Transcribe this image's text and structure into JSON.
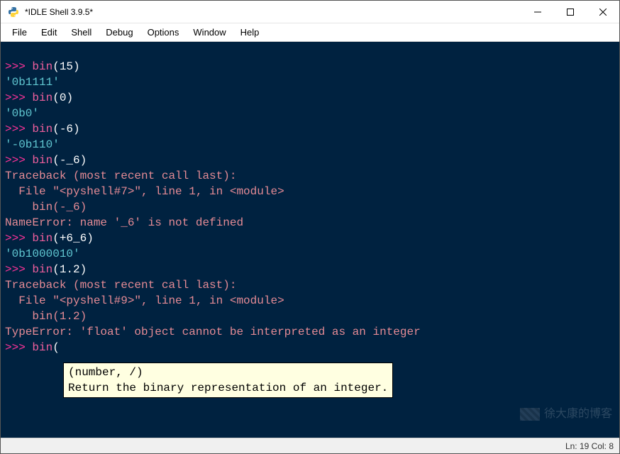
{
  "window": {
    "title": "*IDLE Shell 3.9.5*"
  },
  "menu": {
    "file": "File",
    "edit": "Edit",
    "shell": "Shell",
    "debug": "Debug",
    "options": "Options",
    "window": "Window",
    "help": "Help"
  },
  "lines": {
    "p1_prompt": ">>> ",
    "p1_func": "bin",
    "p1_open": "(",
    "p1_arg": "15",
    "p1_close": ")",
    "o1": "'0b1111'",
    "p2_prompt": ">>> ",
    "p2_func": "bin",
    "p2_open": "(",
    "p2_arg": "0",
    "p2_close": ")",
    "o2": "'0b0'",
    "p3_prompt": ">>> ",
    "p3_func": "bin",
    "p3_open": "(",
    "p3_arg": "-6",
    "p3_close": ")",
    "o3": "'-0b110'",
    "p4_prompt": ">>> ",
    "p4_func": "bin",
    "p4_open": "(",
    "p4_arg": "-_6",
    "p4_close": ")",
    "e1_1": "Traceback (most recent call last):",
    "e1_2": "  File \"<pyshell#7>\", line 1, in <module>",
    "e1_3": "    bin(-_6)",
    "e1_4": "NameError: name '_6' is not defined",
    "p5_prompt": ">>> ",
    "p5_func": "bin",
    "p5_open": "(",
    "p5_arg": "+6_6",
    "p5_close": ")",
    "o5": "'0b1000010'",
    "p6_prompt": ">>> ",
    "p6_func": "bin",
    "p6_open": "(",
    "p6_arg": "1.2",
    "p6_close": ")",
    "e2_1": "Traceback (most recent call last):",
    "e2_2": "  File \"<pyshell#9>\", line 1, in <module>",
    "e2_3": "    bin(1.2)",
    "e2_4": "TypeError: 'float' object cannot be interpreted as an integer",
    "p7_prompt": ">>> ",
    "p7_func": "bin",
    "p7_open": "("
  },
  "tooltip": {
    "line1": "(number, /)",
    "line2": "Return the binary representation of an integer."
  },
  "status": {
    "text": "Ln: 19  Col: 8"
  },
  "watermark": {
    "text": "徐大康的博客"
  }
}
